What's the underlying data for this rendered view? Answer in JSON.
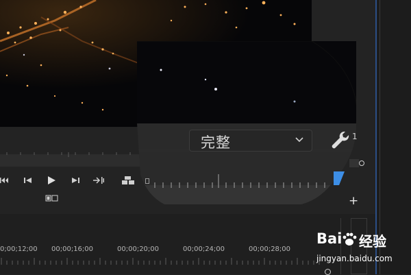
{
  "monitor": {
    "quality": {
      "selected": "完整"
    },
    "wrench_badge": "1"
  },
  "icons": {
    "wrench": "wrench-icon",
    "step_back": "step-back-frame-icon",
    "play": "play-icon",
    "step_forward": "step-forward-frame-icon",
    "go_to_out": "go-to-out-point-icon",
    "go_to_in": "go-to-in-point-icon",
    "lift": "lift-icon",
    "export_frame": "export-frame-icon",
    "add": "plus-icon",
    "playhead": "playhead-marker-icon"
  },
  "timeline": {
    "timecodes": [
      "00;00;12;00",
      "00;00;16;00",
      "00;00;20;00",
      "00;00;24;00",
      "00;00;28;00"
    ],
    "first_visible": "0;00;12;00"
  },
  "watermark": {
    "brand": "Bai",
    "suffix": "经验",
    "url": "jingyan.baidu.com"
  },
  "colors": {
    "accent": "#3d8ee6",
    "background": "#232323",
    "video_bg": "#060608"
  }
}
